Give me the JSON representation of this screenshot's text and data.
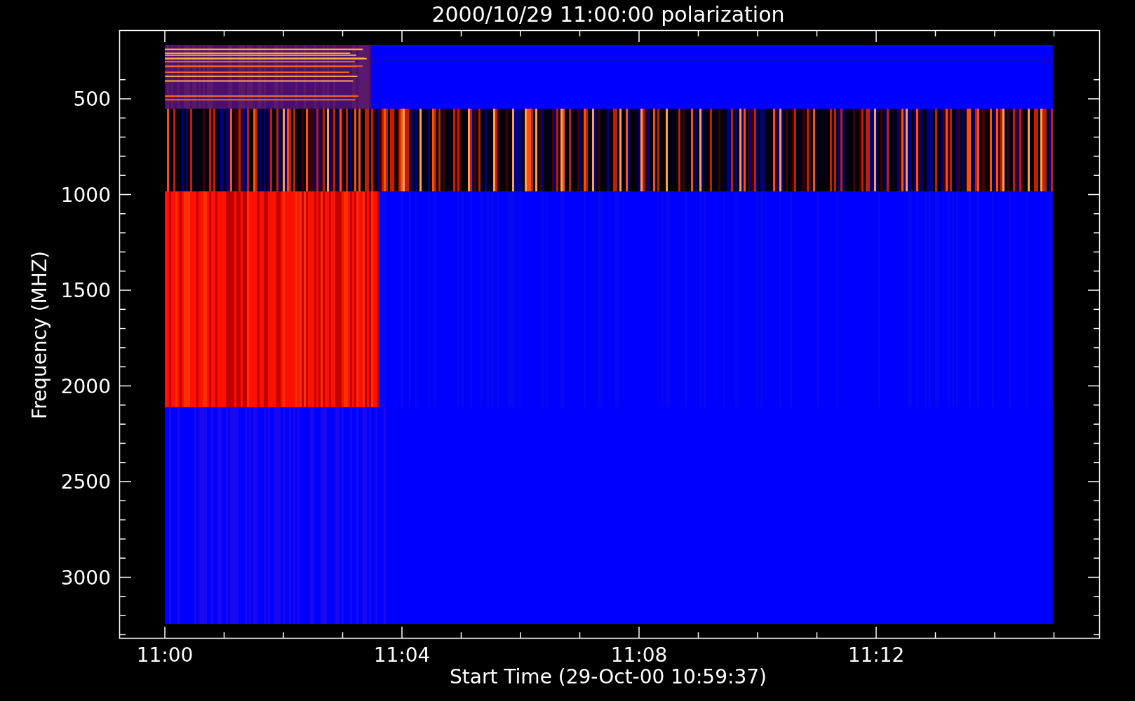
{
  "plot": {
    "title": "2000/10/29 11:00:00 polarization",
    "y_axis": {
      "label": "Frequency (MHZ)",
      "tick_labels": [
        "500",
        "1000",
        "1500",
        "2000",
        "2500",
        "3000"
      ]
    },
    "x_axis": {
      "label": "Start Time (29-Oct-00 10:59:37)",
      "tick_labels": [
        "11:00",
        "11:04",
        "11:08",
        "11:12"
      ]
    }
  }
}
